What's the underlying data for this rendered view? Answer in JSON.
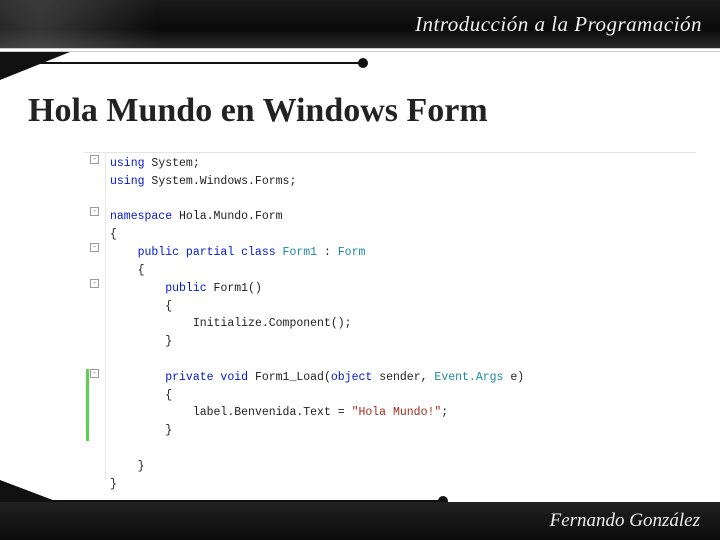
{
  "header": {
    "course_title": "Introducción a la Programación"
  },
  "slide": {
    "title": "Hola Mundo en Windows Form"
  },
  "code": {
    "using1_kw": "using",
    "using1_rest": " System;",
    "using2_kw": "using",
    "using2_rest": " System.Windows.Forms;",
    "ns_kw": "namespace",
    "ns_name": " Hola.Mundo.Form",
    "open_brace": "{",
    "class_mods": "public partial class",
    "class_name": " Form1",
    "class_colon": " : ",
    "class_base": "Form",
    "ctor_mod": "public",
    "ctor_name": " Form1()",
    "ctor_body": "Initialize.Component();",
    "method_mods": "private void",
    "method_name": " Form1_Load(",
    "param1_type": "object",
    "param1_name": " sender, ",
    "param2_type": "Event.Args",
    "param2_name": " e",
    "method_close": ")",
    "load_body_prefix": "label.Benvenida.Text = ",
    "load_body_string": "\"Hola Mundo!\"",
    "load_body_suffix": ";",
    "close_brace": "}"
  },
  "footer": {
    "author": "Fernando González"
  }
}
